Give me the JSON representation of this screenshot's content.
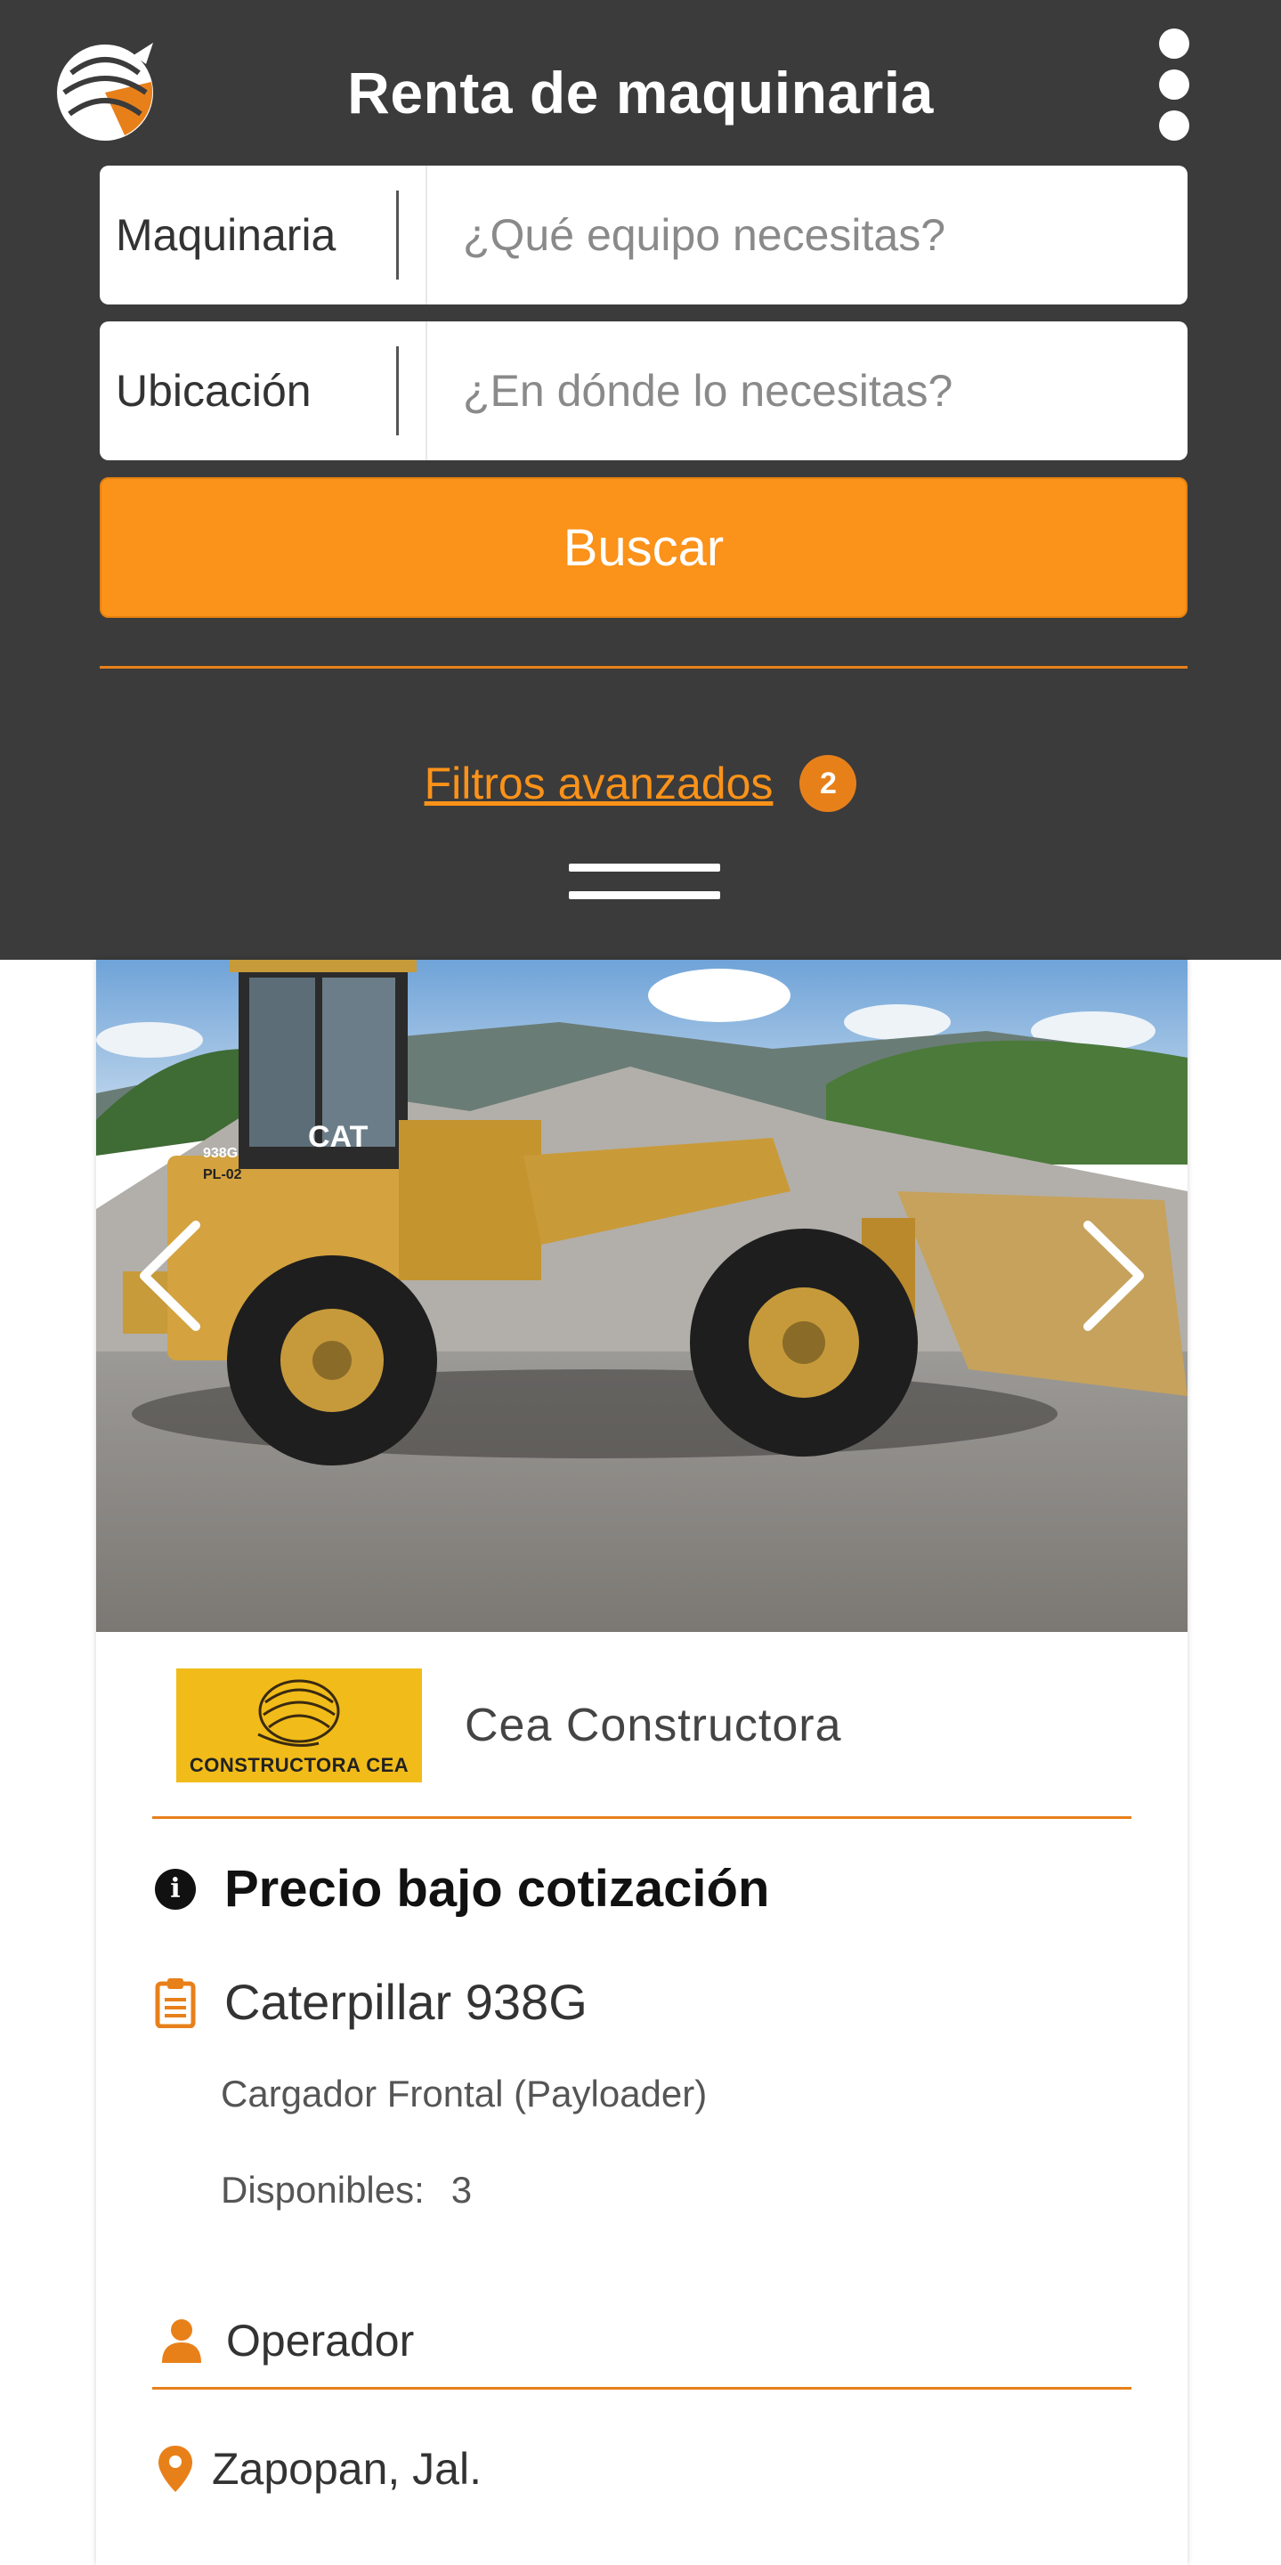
{
  "header": {
    "title": "Renta de maquinaria",
    "menu_icon": "kebab-menu-icon",
    "logo_icon": "armadillo-logo-icon"
  },
  "search": {
    "machinery_label": "Maquinaria",
    "machinery_placeholder": "¿Qué equipo necesitas?",
    "location_label": "Ubicación",
    "location_placeholder": "¿En dónde lo necesitas?",
    "button_label": "Buscar"
  },
  "filters": {
    "link_label": "Filtros avanzados",
    "badge_count": "2"
  },
  "listing": {
    "company_name": "Cea Constructora",
    "company_logo_text": "CONSTRUCTORA CEA",
    "price_label": "Precio bajo cotización",
    "model": "Caterpillar 938G",
    "category": "Cargador Frontal (Payloader)",
    "available_label": "Disponibles:",
    "available_count": "3",
    "operator_label": "Operador",
    "location": "Zapopan, Jal.",
    "photo_brand": "CAT",
    "photo_model_plate": "938G",
    "photo_unit_id": "PL-02"
  },
  "colors": {
    "header_bg": "#3b3b3b",
    "accent": "#fb9219",
    "accent_dark": "#e8801a",
    "company_logo_bg": "#f1bc19"
  }
}
